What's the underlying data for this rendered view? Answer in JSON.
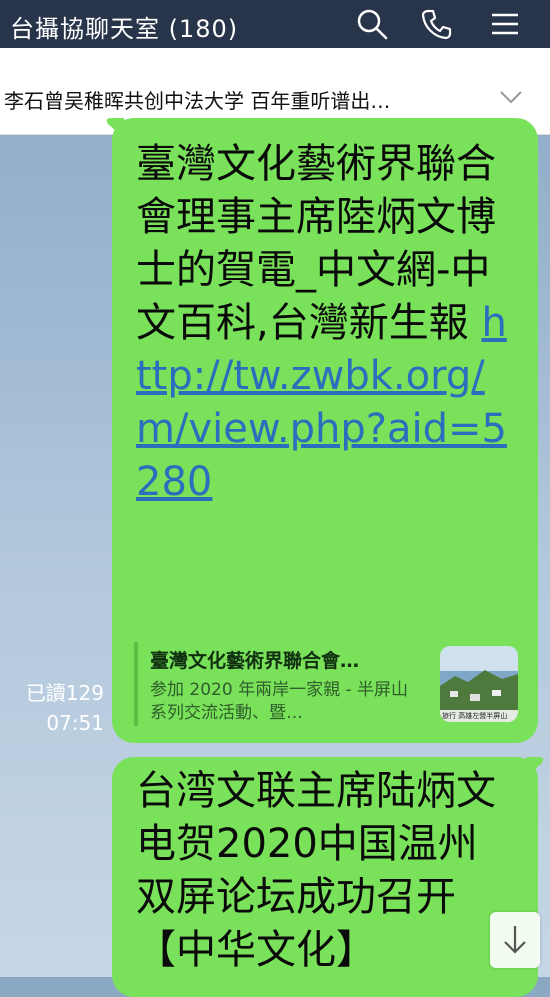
{
  "header": {
    "title": "台攝協聊天室 (180)",
    "icons": [
      "search-icon",
      "phone-icon",
      "menu-icon"
    ]
  },
  "announcement": {
    "text": "李石曾吴稚晖共创中法大学 百年重听谱出…",
    "chevron": "chevron-down-icon"
  },
  "messages": [
    {
      "text_lines": [
        "臺灣文化藝術界聯",
        "合會理事主席陸炳",
        "文博士的賀電_中",
        "文網-中文百科,台",
        "灣新生報 "
      ],
      "link": "http://tw.zwbk.org/m/view.php?aid=5280",
      "preview": {
        "title": "臺灣文化藝術界聯合會…",
        "description": "参加 2020 年兩岸一家親 - 半屏山系列交流活動、暨…",
        "thumb_caption": "旅行 高雄左營半屏山"
      },
      "read_status": "已讀129",
      "time": "07:51"
    },
    {
      "text_lines": [
        "台湾文联主席陆炳",
        "文电贺2020中国",
        "温州双屏论坛成功",
        "召开【中华文化】"
      ]
    }
  ],
  "colors": {
    "header_bg": "#27344a",
    "bubble_green": "#79e15a",
    "link_blue": "#2a6ebd"
  },
  "scroll_button": "arrow-down-icon"
}
